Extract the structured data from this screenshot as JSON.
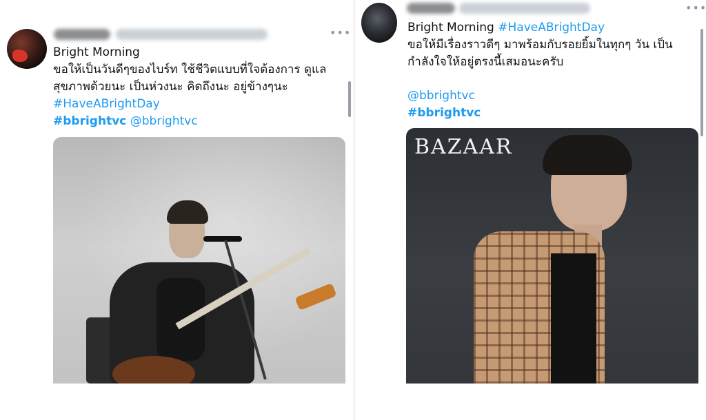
{
  "tweets": [
    {
      "author_display": "minmin a",
      "handle": "@yangyangmi · 1 นาที",
      "lines": [
        "Bright Morning",
        "ขอให้เป็นวันดีๆของไบร์ท ใช้ชีวิตแบบที่ใจต้องการ ดูแล",
        "สุขภาพด้วยนะ เป็นห่วงนะ คิดถึงนะ อยู่ข้างๆนะ",
        "#HaveABrightDay"
      ],
      "hashtag_bold": "#bbrightvc",
      "mention": "@bbrightvc",
      "media_alt": "Singer playing bass guitar on stage"
    },
    {
      "author_display": "brightvc",
      "handle": "@bbrightvc · 1 ชม.",
      "headline": "Bright Morning",
      "headline_hashtag": "#HaveABrightDay",
      "lines": [
        "ขอให้มีเรื่องราวดีๆ มาพร้อมกับรอยยิ้มในทุกๆ วัน เป็น",
        "กำลังใจให้อยู่ตรงนี้เสมอนะครับ"
      ],
      "mention": "@bbrightvc",
      "hashtag_bold": "#bbrightvc",
      "media_logo": "BAZAAR",
      "media_alt": "Magazine cover portrait"
    }
  ],
  "icons": {
    "more": "more-icon"
  },
  "colors": {
    "link": "#1d9bf0",
    "text": "#0f1419",
    "muted": "#8b98a5"
  }
}
